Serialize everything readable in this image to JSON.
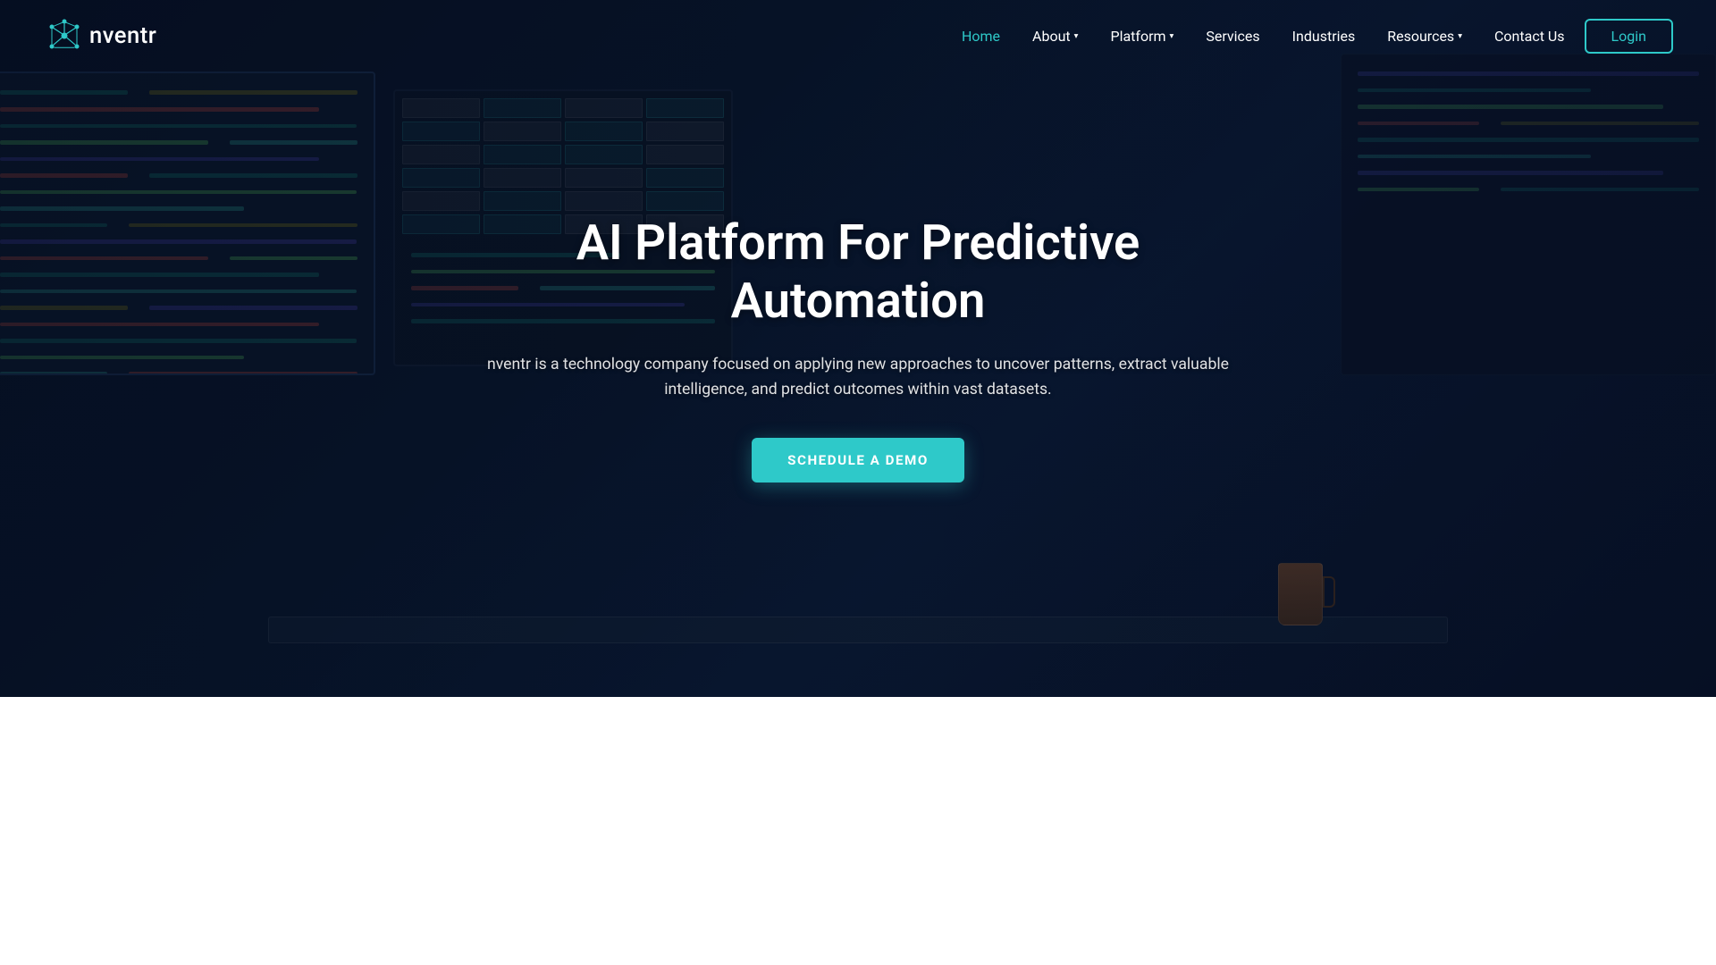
{
  "brand": {
    "name": "nventr",
    "logo_alt": "nventr logo"
  },
  "navbar": {
    "home_label": "Home",
    "about_label": "About",
    "platform_label": "Platform",
    "services_label": "Services",
    "industries_label": "Industries",
    "resources_label": "Resources",
    "contact_label": "Contact Us",
    "login_label": "Login"
  },
  "hero": {
    "title": "AI Platform For Predictive Automation",
    "subtitle": "nventr is a technology company focused on applying new approaches to uncover patterns, extract valuable intelligence, and predict outcomes within vast datasets.",
    "cta_label": "SCHEDULE A DEMO"
  },
  "colors": {
    "accent": "#2ec9c9",
    "dark_bg": "#050f23",
    "white": "#ffffff"
  }
}
